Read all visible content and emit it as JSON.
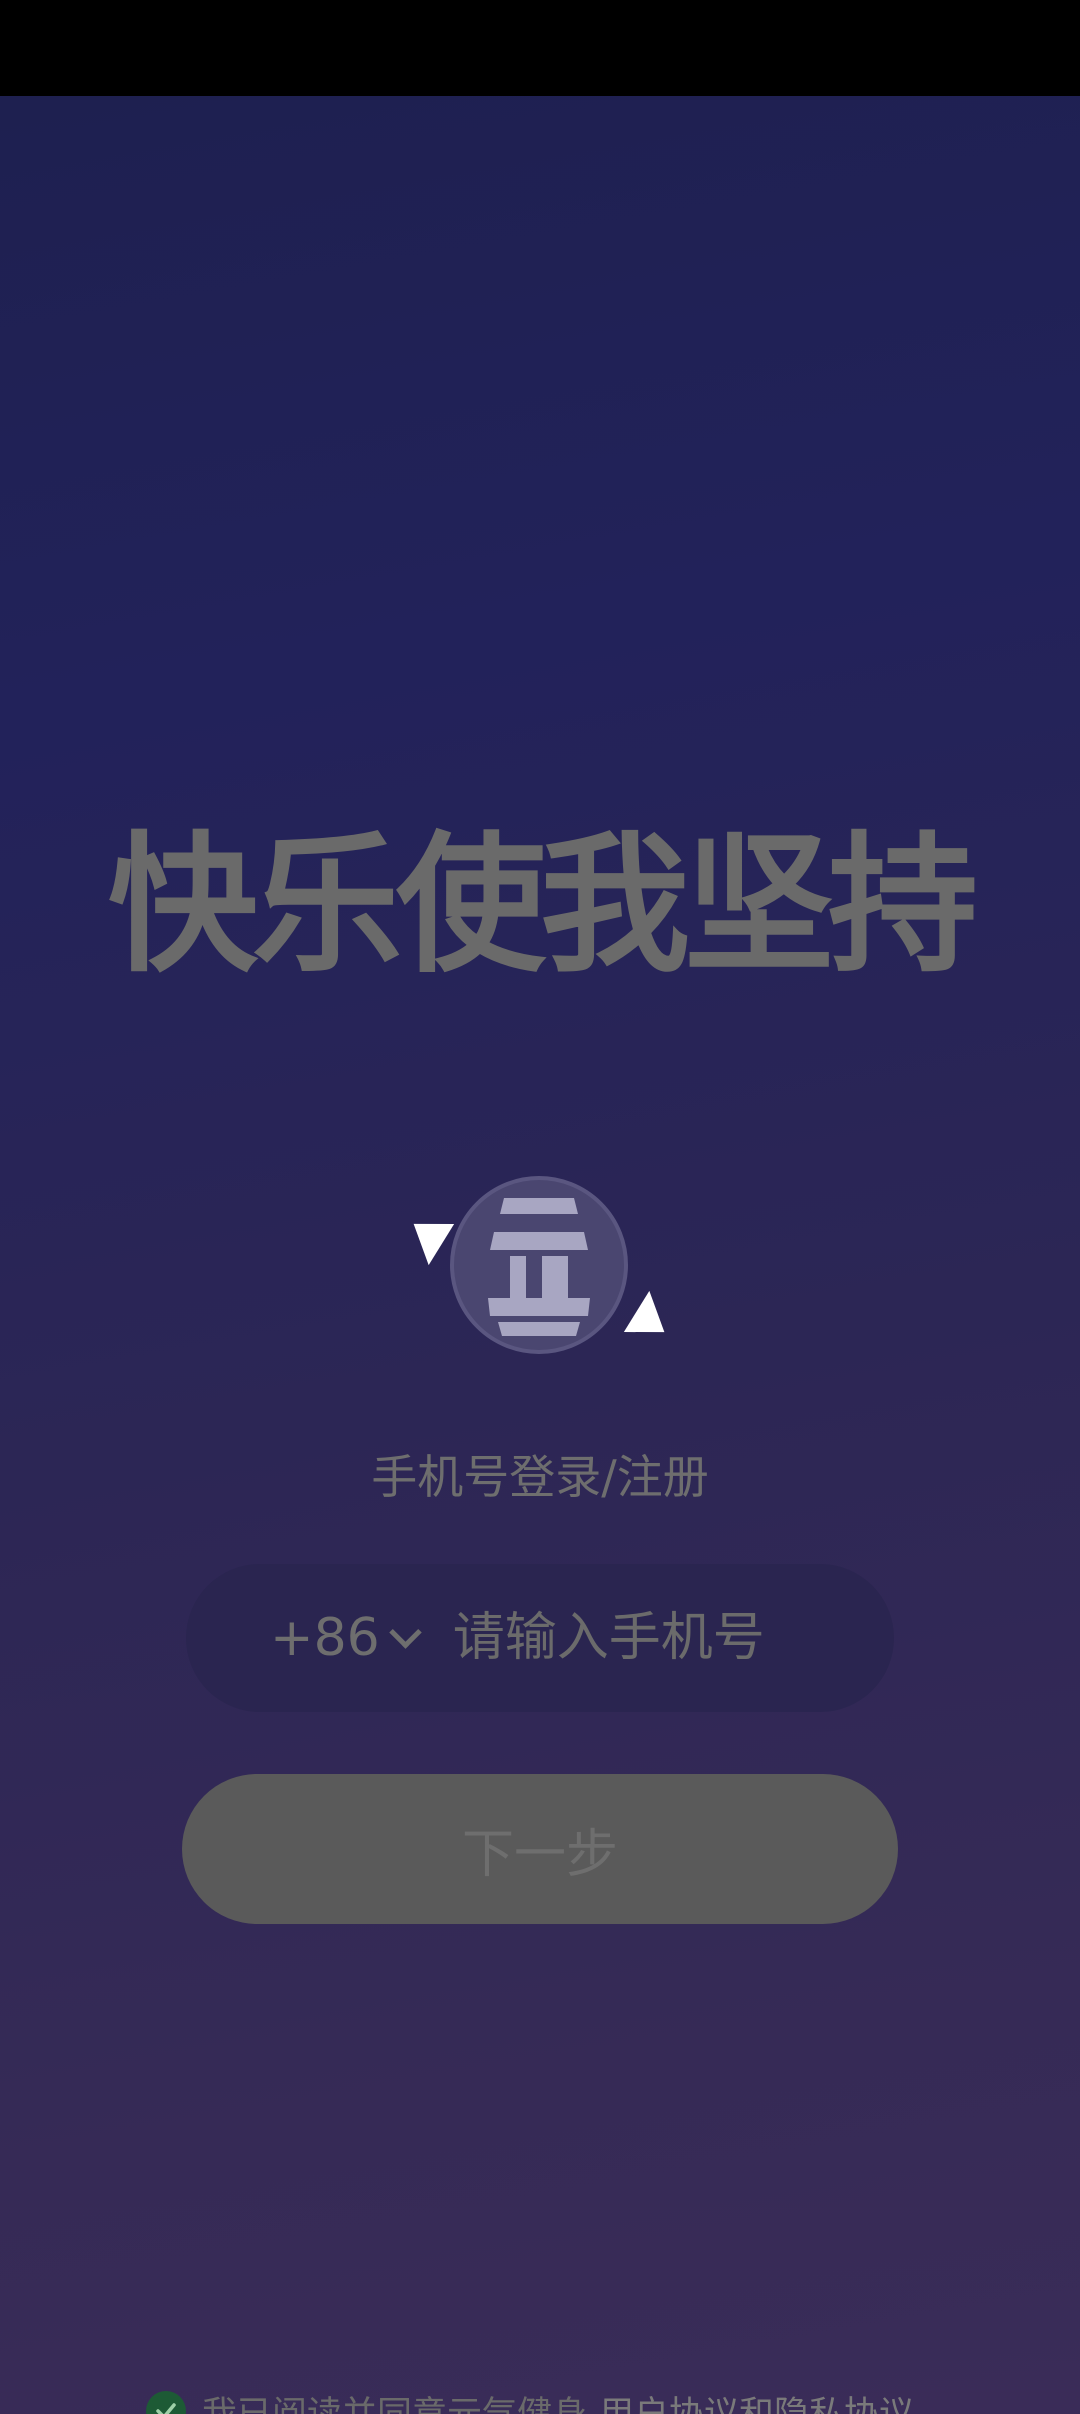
{
  "slogan": "快乐使我坚持",
  "login": {
    "title": "手机号登录/注册",
    "country_code": "+86",
    "phone_placeholder": "请输入手机号",
    "next_button": "下一步"
  },
  "agreement": {
    "text": "我已阅读并同意元气健身",
    "links": "用户协议和隐私协议"
  },
  "colors": {
    "accent_check": "#1d5a35",
    "button_bg": "#5a5a5a"
  },
  "icons": {
    "logo": "app-logo-icon",
    "chevron": "chevron-down-icon",
    "check": "check-circle-icon"
  }
}
